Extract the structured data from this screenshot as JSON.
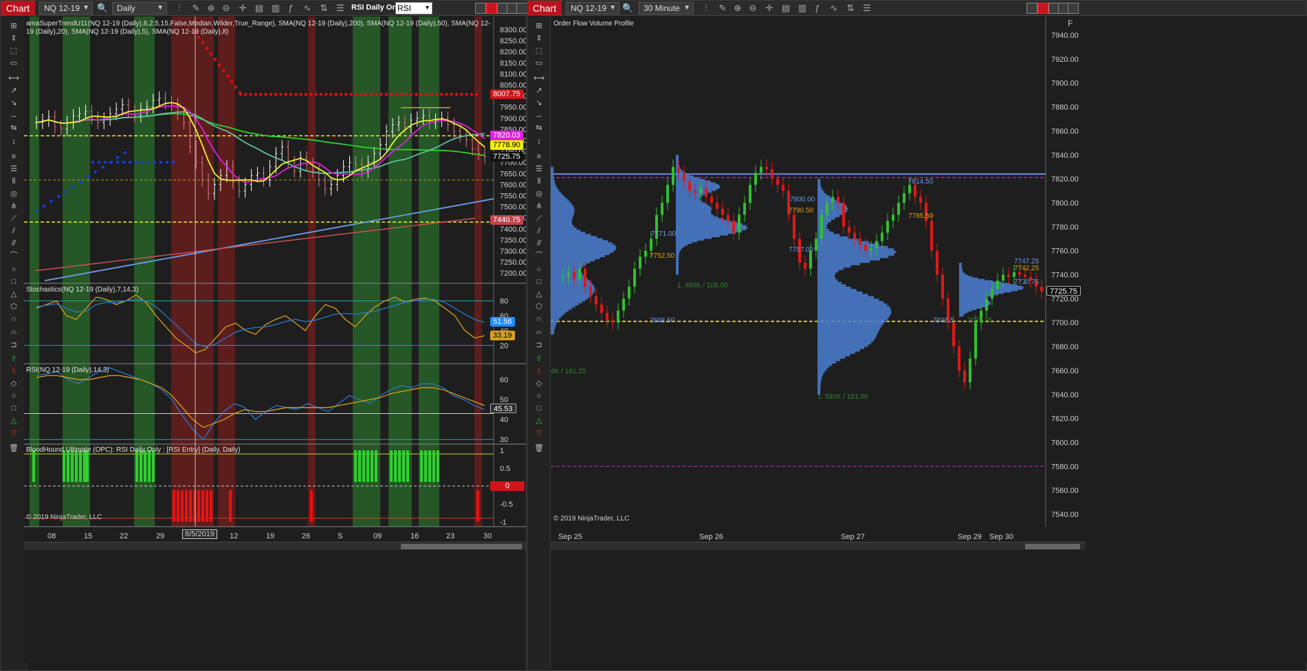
{
  "left": {
    "title_tab": "Chart",
    "instrument": "NQ 12-19",
    "period": "Daily",
    "strategy_label": "RSI Daily Only",
    "strategy_select": "RSI Entry",
    "price_panel_title": "amaSuperTrendU11(NQ 12-19 (Daily),8,2.5,15,False,Median,Wilder,True_Range), SMA(NQ 12-19 (Daily),200), SMA(NQ 12-19 (Daily),50), SMA(NQ 12-19 (Daily),20), SMA(NQ 12-19 (Daily),5), SMA(NQ 12-19 (Daily),8)",
    "stoch_title": "Stochastics(NQ 12-19 (Daily),7,14,3)",
    "rsi_title": "RSI(NQ 12-19 (Daily),14,3)",
    "bloodhound_title": "BloodHound Ultimate (OPC): RSI Daily Only : [RSI Entry] (Daily, Daily)",
    "copyright": "© 2019 NinjaTrader, LLC",
    "price_axis": [
      "8300.00",
      "8250.00",
      "8200.00",
      "8150.00",
      "8100.00",
      "8050.00",
      "8000.00",
      "7950.00",
      "7900.00",
      "7850.00",
      "7800.00",
      "7750.00",
      "7700.00",
      "7650.00",
      "7600.00",
      "7550.00",
      "7500.00",
      "7450.00",
      "7400.00",
      "7350.00",
      "7300.00",
      "7250.00",
      "7200.00"
    ],
    "price_tags": [
      {
        "text": "8007.75",
        "bg": "#d1141c",
        "fg": "#ffffff"
      },
      {
        "text": "7820.03",
        "bg": "#e020e0",
        "fg": "#ffffff"
      },
      {
        "text": "7778.90",
        "bg": "#f0f000",
        "fg": "#000000"
      },
      {
        "text": "7725.75",
        "bg": "#111111",
        "fg": "#ffffff"
      },
      {
        "text": "7440.75",
        "bg": "#c0444a",
        "fg": "#ffffff"
      }
    ],
    "stoch_axis": [
      "80",
      "60",
      "40",
      "20"
    ],
    "stoch_tags": [
      {
        "text": "51.56",
        "bg": "#1e90ff",
        "fg": "#ffffff"
      },
      {
        "text": "33.19",
        "bg": "#d8a020",
        "fg": "#000000"
      }
    ],
    "rsi_axis": [
      "60",
      "50",
      "40",
      "30"
    ],
    "rsi_tag": "45.53",
    "bh_axis": [
      "1",
      "0.5",
      "0",
      "-0.5",
      "-1"
    ],
    "bh_zero_tag": "0",
    "dates": [
      "08",
      "15",
      "22",
      "29",
      "8/5/2019",
      "12",
      "19",
      "26",
      "S",
      "09",
      "16",
      "23",
      "30"
    ]
  },
  "right": {
    "title_tab": "Chart",
    "instrument": "NQ 12-19",
    "period": "30 Minute",
    "panel_title": "Order Flow Volume Profile",
    "copyright": "© 2019 NinjaTrader, LLC",
    "price_axis": [
      "7940.00",
      "7920.00",
      "7900.00",
      "7880.00",
      "7860.00",
      "7840.00",
      "7820.00",
      "7800.00",
      "7780.00",
      "7760.00",
      "7740.00",
      "7720.00",
      "7700.00",
      "7680.00",
      "7660.00",
      "7640.00",
      "7620.00",
      "7600.00",
      "7580.00",
      "7560.00",
      "7540.00"
    ],
    "last_price": "7725.75",
    "corner_label": "F",
    "profile_labels": [
      "7814.50",
      "7800.00",
      "7790.50",
      "7785.50",
      "7771.00",
      "7757.00",
      "7752.50",
      "7747.25",
      "7742.25",
      "7730.75",
      "7698.50",
      "7698.5",
      "1: 486K / 108.00",
      "1: 591K / 181.00",
      "4K / 181.25",
      "7697.25"
    ],
    "dates": [
      "Sep 25",
      "Sep 26",
      "Sep 27",
      "Sep 29",
      "Sep 30"
    ]
  },
  "colors": {
    "bull_zone": "#2a6b2a",
    "bear_zone": "#6b1d1d",
    "supertrend_bear": "#e01010",
    "supertrend_bull": "#1040e0",
    "sma200": "#d05050",
    "sma50": "#30d030",
    "sma20": "#60c0a0",
    "sma5": "#f0f030",
    "sma8": "#e020e0",
    "trend_line": "#6aa0f0",
    "profile": "#4a7ed0"
  }
}
